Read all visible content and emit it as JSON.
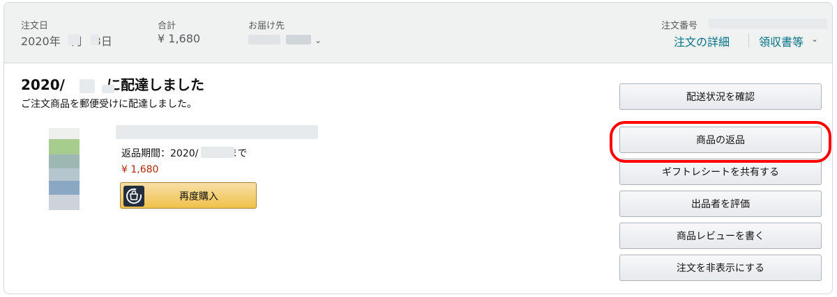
{
  "header": {
    "order_date_label": "注文日",
    "order_date_value": "2020年　月　3日",
    "total_label": "合計",
    "total_value": "¥ 1,680",
    "ship_to_label": "お届け先",
    "order_number_label": "注文番号",
    "order_details_link": "注文の詳細",
    "receipt_link": "領収書等"
  },
  "shipment": {
    "headline": "2020/　　　に配達しました",
    "subtext": "ご注文商品を郵便受けに配達しました。"
  },
  "item": {
    "return_period": "返品期間：2020/　　　まで",
    "price": "¥ 1,680",
    "buy_again_label": "再度購入",
    "buy_again_icon": "buy-again-icon"
  },
  "actions": [
    {
      "label": "配送状況を確認"
    },
    {
      "label": "商品の返品",
      "highlighted": true
    },
    {
      "label": "ギフトレシートを共有する"
    },
    {
      "label": "出品者を評価"
    },
    {
      "label": "商品レビューを書く"
    },
    {
      "label": "注文を非表示にする"
    }
  ],
  "colors": {
    "link": "#007185",
    "price": "#b12704",
    "highlight": "#ff0000",
    "buy_again": "#f0c14b"
  }
}
